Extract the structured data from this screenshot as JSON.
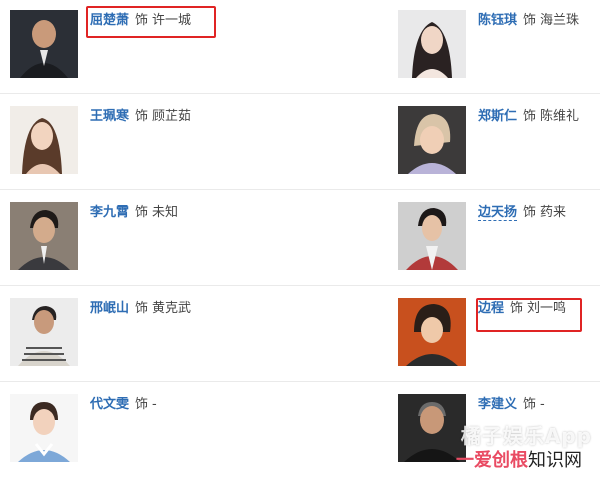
{
  "cast": [
    {
      "left": {
        "actor": "屈楚萧",
        "as": "饰",
        "role": "许一城"
      },
      "right": {
        "actor": "陈钰琪",
        "as": "饰",
        "role": "海兰珠"
      }
    },
    {
      "left": {
        "actor": "王珮寒",
        "as": "饰",
        "role": "顾芷茹"
      },
      "right": {
        "actor": "郑斯仁",
        "as": "饰",
        "role": "陈维礼"
      }
    },
    {
      "left": {
        "actor": "李九霄",
        "as": "饰",
        "role": "未知"
      },
      "right": {
        "actor": "边天扬",
        "as": "饰",
        "role": "药来"
      }
    },
    {
      "left": {
        "actor": "邢岷山",
        "as": "饰",
        "role": "黄克武"
      },
      "right": {
        "actor": "边程",
        "as": "饰",
        "role": "刘一鸣"
      }
    },
    {
      "left": {
        "actor": "代文雯",
        "as": "饰",
        "role": "-"
      },
      "right": {
        "actor": "李建义",
        "as": "饰",
        "role": "-"
      }
    }
  ],
  "watermark": {
    "line1": "橘子娱乐App",
    "line2a": "一爱创根",
    "line2b": "知识网"
  },
  "colors": {
    "link": "#2e6db4",
    "highlight": "#e02424"
  }
}
